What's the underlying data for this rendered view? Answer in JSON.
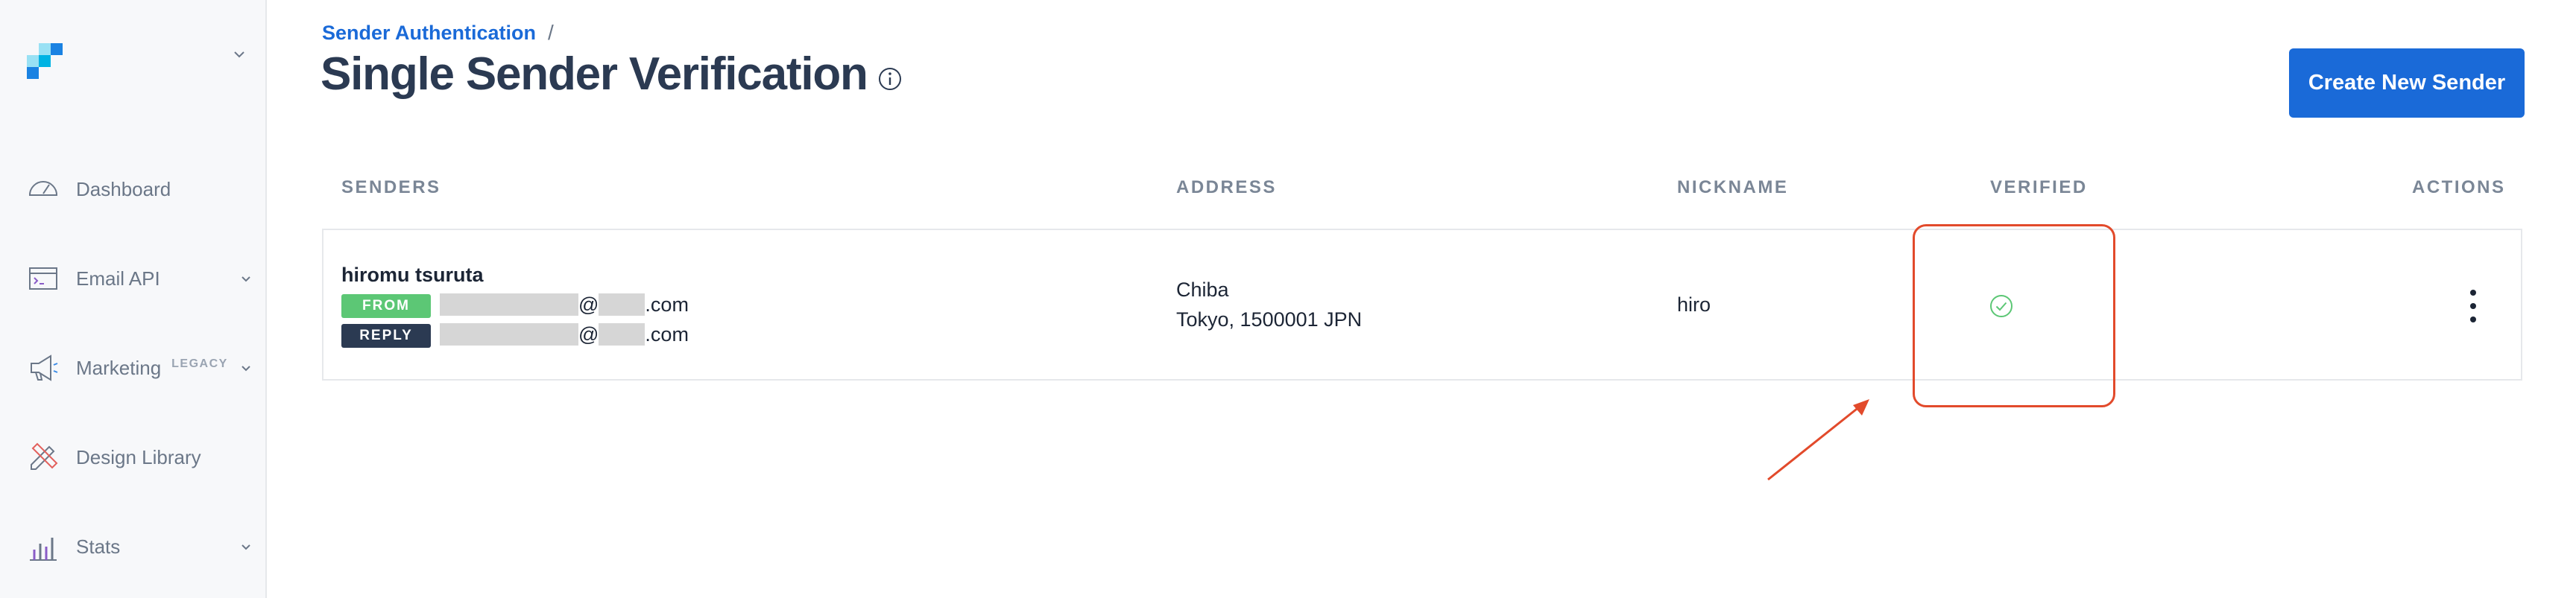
{
  "sidebar": {
    "logo": "sendgrid-logo",
    "items": [
      {
        "label": "Dashboard",
        "icon": "gauge-icon",
        "has_chevron": false
      },
      {
        "label": "Email API",
        "icon": "code-window-icon",
        "has_chevron": true
      },
      {
        "label": "Marketing",
        "badge": "LEGACY",
        "icon": "megaphone-icon",
        "has_chevron": true
      },
      {
        "label": "Design Library",
        "icon": "pencil-ruler-icon",
        "has_chevron": false
      },
      {
        "label": "Stats",
        "icon": "bar-chart-icon",
        "has_chevron": true
      }
    ]
  },
  "header": {
    "breadcrumb": {
      "link": "Sender Authentication",
      "separator": "/"
    },
    "title": "Single Sender Verification",
    "create_button": "Create New Sender"
  },
  "table": {
    "columns": [
      "SENDERS",
      "ADDRESS",
      "NICKNAME",
      "VERIFIED",
      "ACTIONS"
    ],
    "rows": [
      {
        "name": "hiromu tsuruta",
        "from_tag": "FROM",
        "reply_tag": "REPLY",
        "email_at": "@",
        "email_tld": ".com",
        "address_line1": "Chiba",
        "address_line2": "Tokyo, 1500001 JPN",
        "nickname": "hiro",
        "verified": true
      }
    ]
  },
  "colors": {
    "accent": "#1a6ad8",
    "title": "#2b3a52",
    "from_tag": "#5cc775",
    "reply_tag": "#2b3a52",
    "verified": "#5cc775",
    "annotation": "#e24a2b"
  }
}
